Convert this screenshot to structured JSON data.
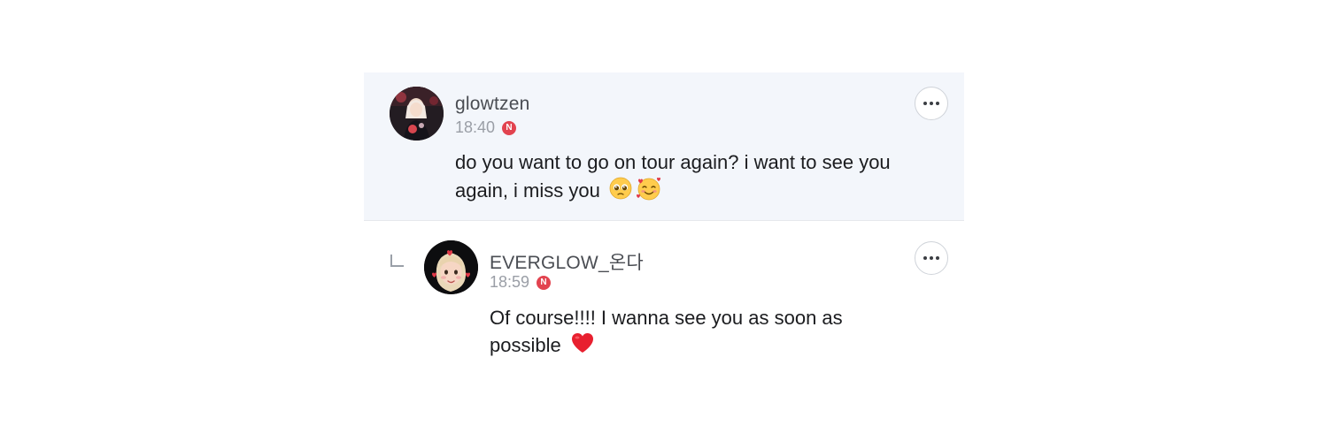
{
  "comments": [
    {
      "username": "glowtzen",
      "time": "18:40",
      "badge": "N",
      "text": "do you want to go on tour again? i want to see you again, i miss you",
      "emojis": [
        "pleading-face-icon",
        "smiling-face-with-hearts-icon"
      ]
    },
    {
      "username": "EVERGLOW_온다",
      "time": "18:59",
      "badge": "N",
      "text": "Of course!!!! I wanna see you as soon as possible",
      "emojis": [
        "red-heart-icon"
      ]
    }
  ],
  "colors": {
    "parent_bg": "#f3f6fb",
    "badge": "#e2434f",
    "username": "#4a4d53",
    "time": "#9a9ea6"
  }
}
